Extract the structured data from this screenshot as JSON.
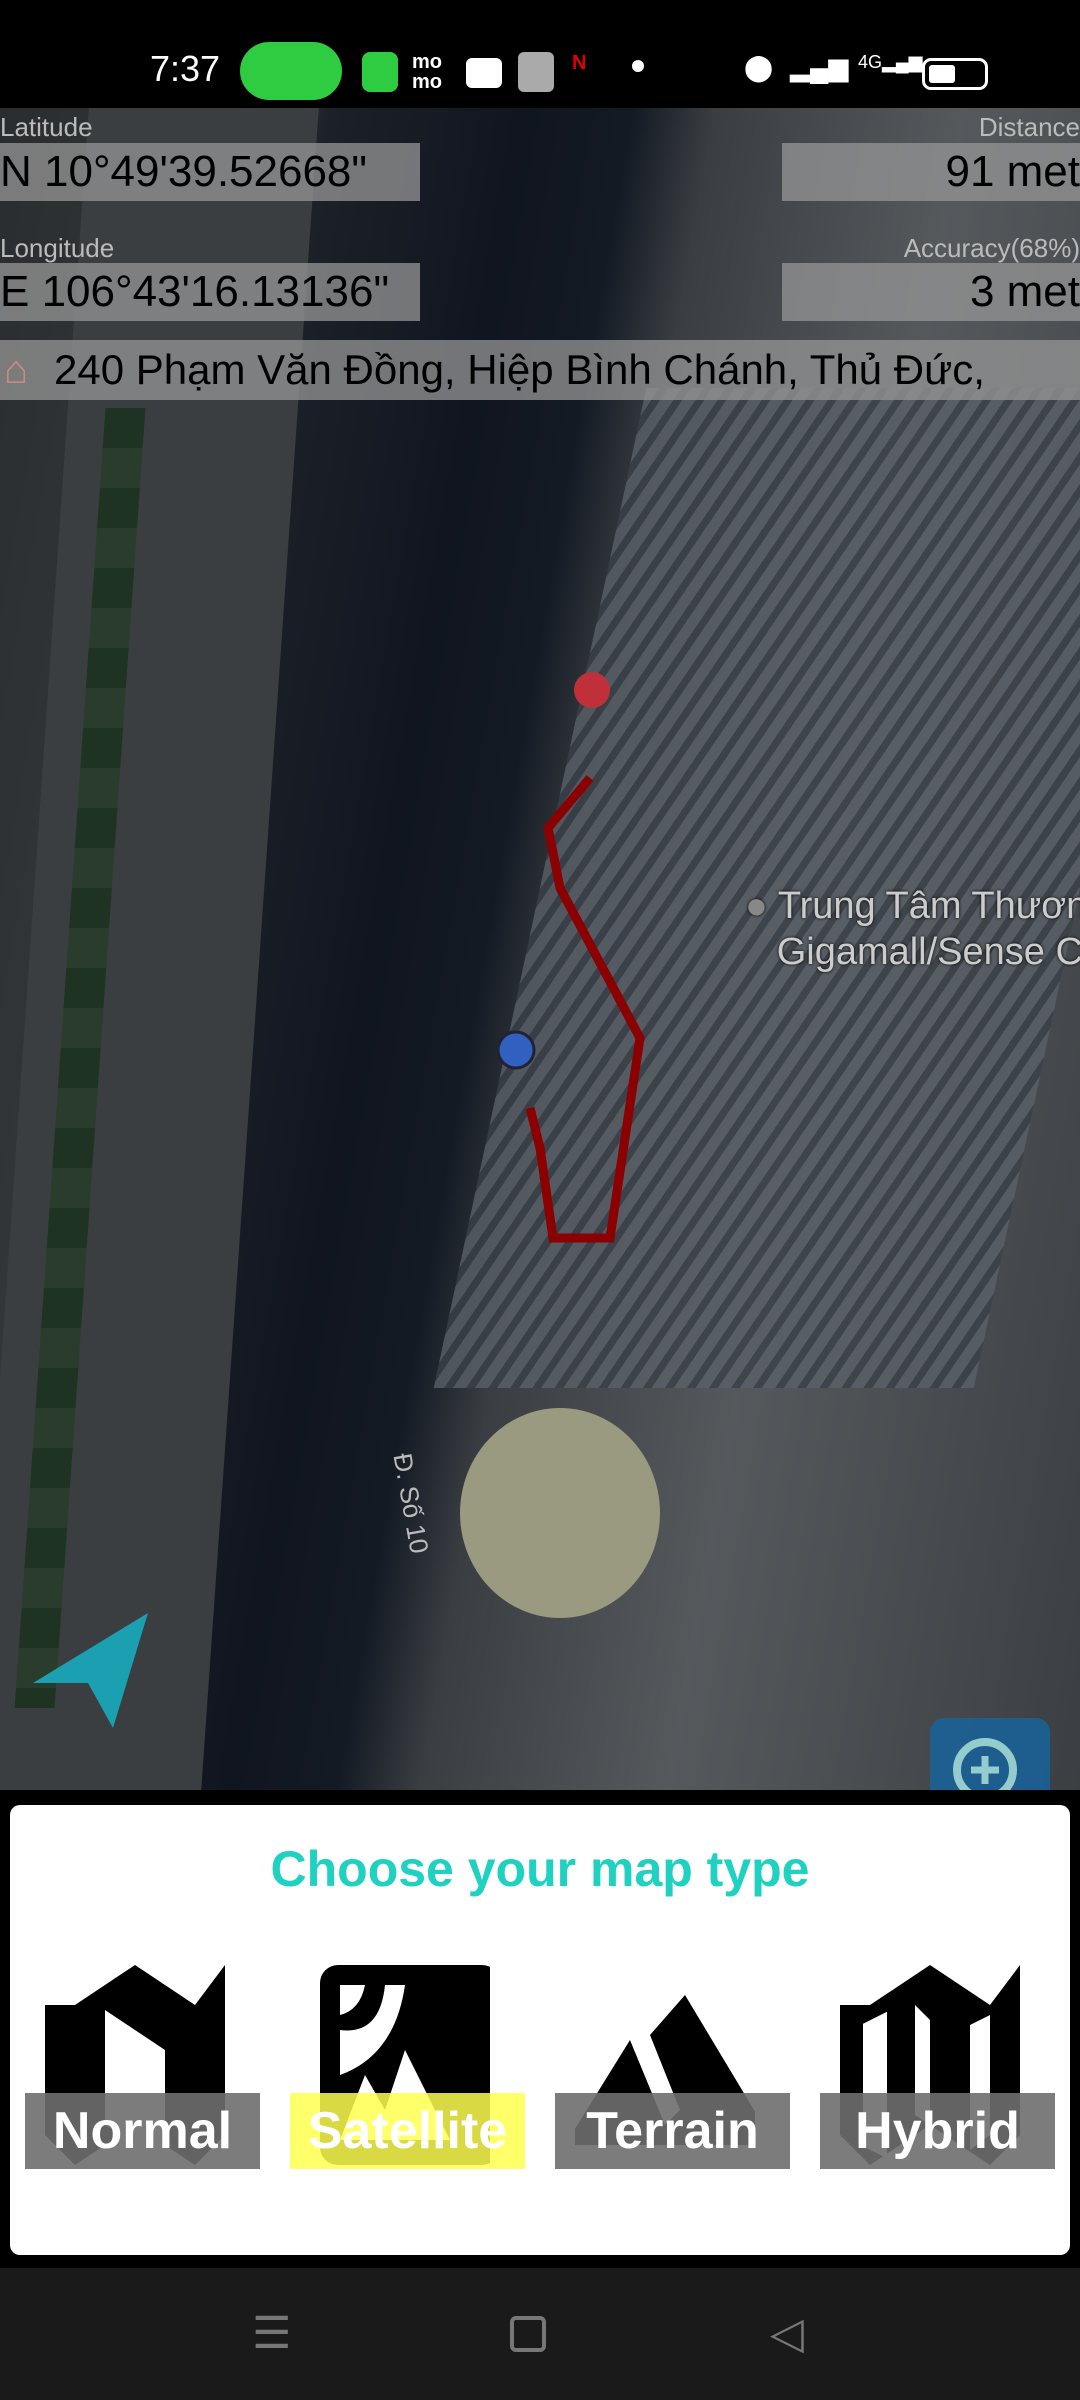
{
  "status_bar": {
    "time": "7:37",
    "icons": [
      "hotspot-icon",
      "app-icon",
      "momo-icon",
      "youtube-icon",
      "maps-icon",
      "localnow-icon",
      "dot-icon",
      "location-icon",
      "signal-icon",
      "4g-signal-icon",
      "battery-icon"
    ],
    "network": "4G"
  },
  "info": {
    "latitude_label": "Latitude",
    "latitude_value": "N 10°49'39.52668\"",
    "longitude_label": "Longitude",
    "longitude_value": "E 106°43'16.13136\"",
    "distance_label": "Distance",
    "distance_value": "91 met",
    "accuracy_label": "Accuracy(68%)",
    "accuracy_value": "3 met",
    "address": "240 Phạm Văn Đồng, Hiệp Bình Chánh, Thủ Đức,"
  },
  "map": {
    "poi_line1": "Trung Tâm Thươn",
    "poi_line2": "Gigamall/Sense C",
    "road_label": "Đ. Số 10",
    "track_color": "#8b0000"
  },
  "panel": {
    "title": "Choose your map type",
    "title_color": "#1fd1c1",
    "options": [
      {
        "label": "Normal",
        "icon": "folded-map-icon"
      },
      {
        "label": "Satellite",
        "icon": "satellite-icon",
        "selected": true
      },
      {
        "label": "Terrain",
        "icon": "mountain-icon"
      },
      {
        "label": "Hybrid",
        "icon": "hybrid-map-icon"
      }
    ]
  },
  "nav_bar": {
    "icons": [
      "menu-icon",
      "home-icon",
      "back-icon"
    ]
  }
}
